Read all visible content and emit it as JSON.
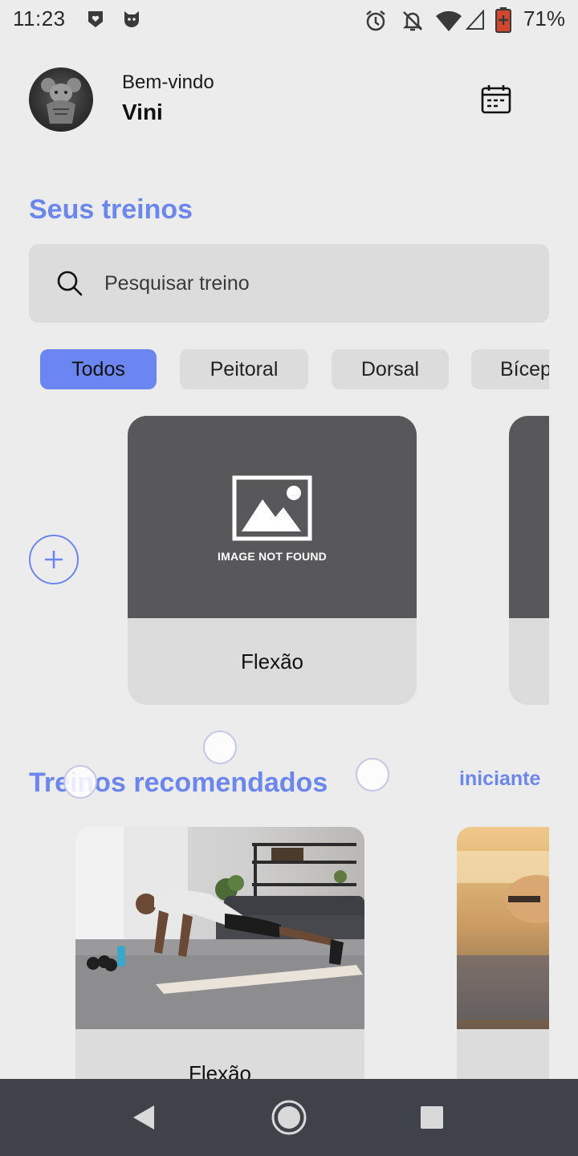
{
  "status_bar": {
    "time": "11:23",
    "battery_percent": "71%",
    "icons": [
      "heart-shield-icon",
      "cat-icon",
      "alarm-icon",
      "notifications-off-icon",
      "wifi-icon",
      "cell-signal-icon",
      "battery-icon"
    ]
  },
  "header": {
    "welcome": "Bem-vindo",
    "username": "Vini",
    "avatar_icon": "avatar",
    "calendar_icon": "calendar-icon"
  },
  "workouts": {
    "title": "Seus treinos",
    "search_placeholder": "Pesquisar treino",
    "chips": [
      {
        "label": "Todos",
        "active": true
      },
      {
        "label": "Peitoral",
        "active": false
      },
      {
        "label": "Dorsal",
        "active": false
      },
      {
        "label": "Bícep",
        "active": false
      }
    ],
    "cards": [
      {
        "label": "Flexão",
        "image_text": "IMAGE NOT FOUND"
      }
    ]
  },
  "recommended": {
    "title": "Treinos recomendados",
    "level_link": "iniciante",
    "cards": [
      {
        "label": "Flexão"
      }
    ]
  },
  "colors": {
    "accent": "#6b86f0",
    "background": "#ececec",
    "card": "#dcdcdc",
    "nav": "#3f4248"
  }
}
